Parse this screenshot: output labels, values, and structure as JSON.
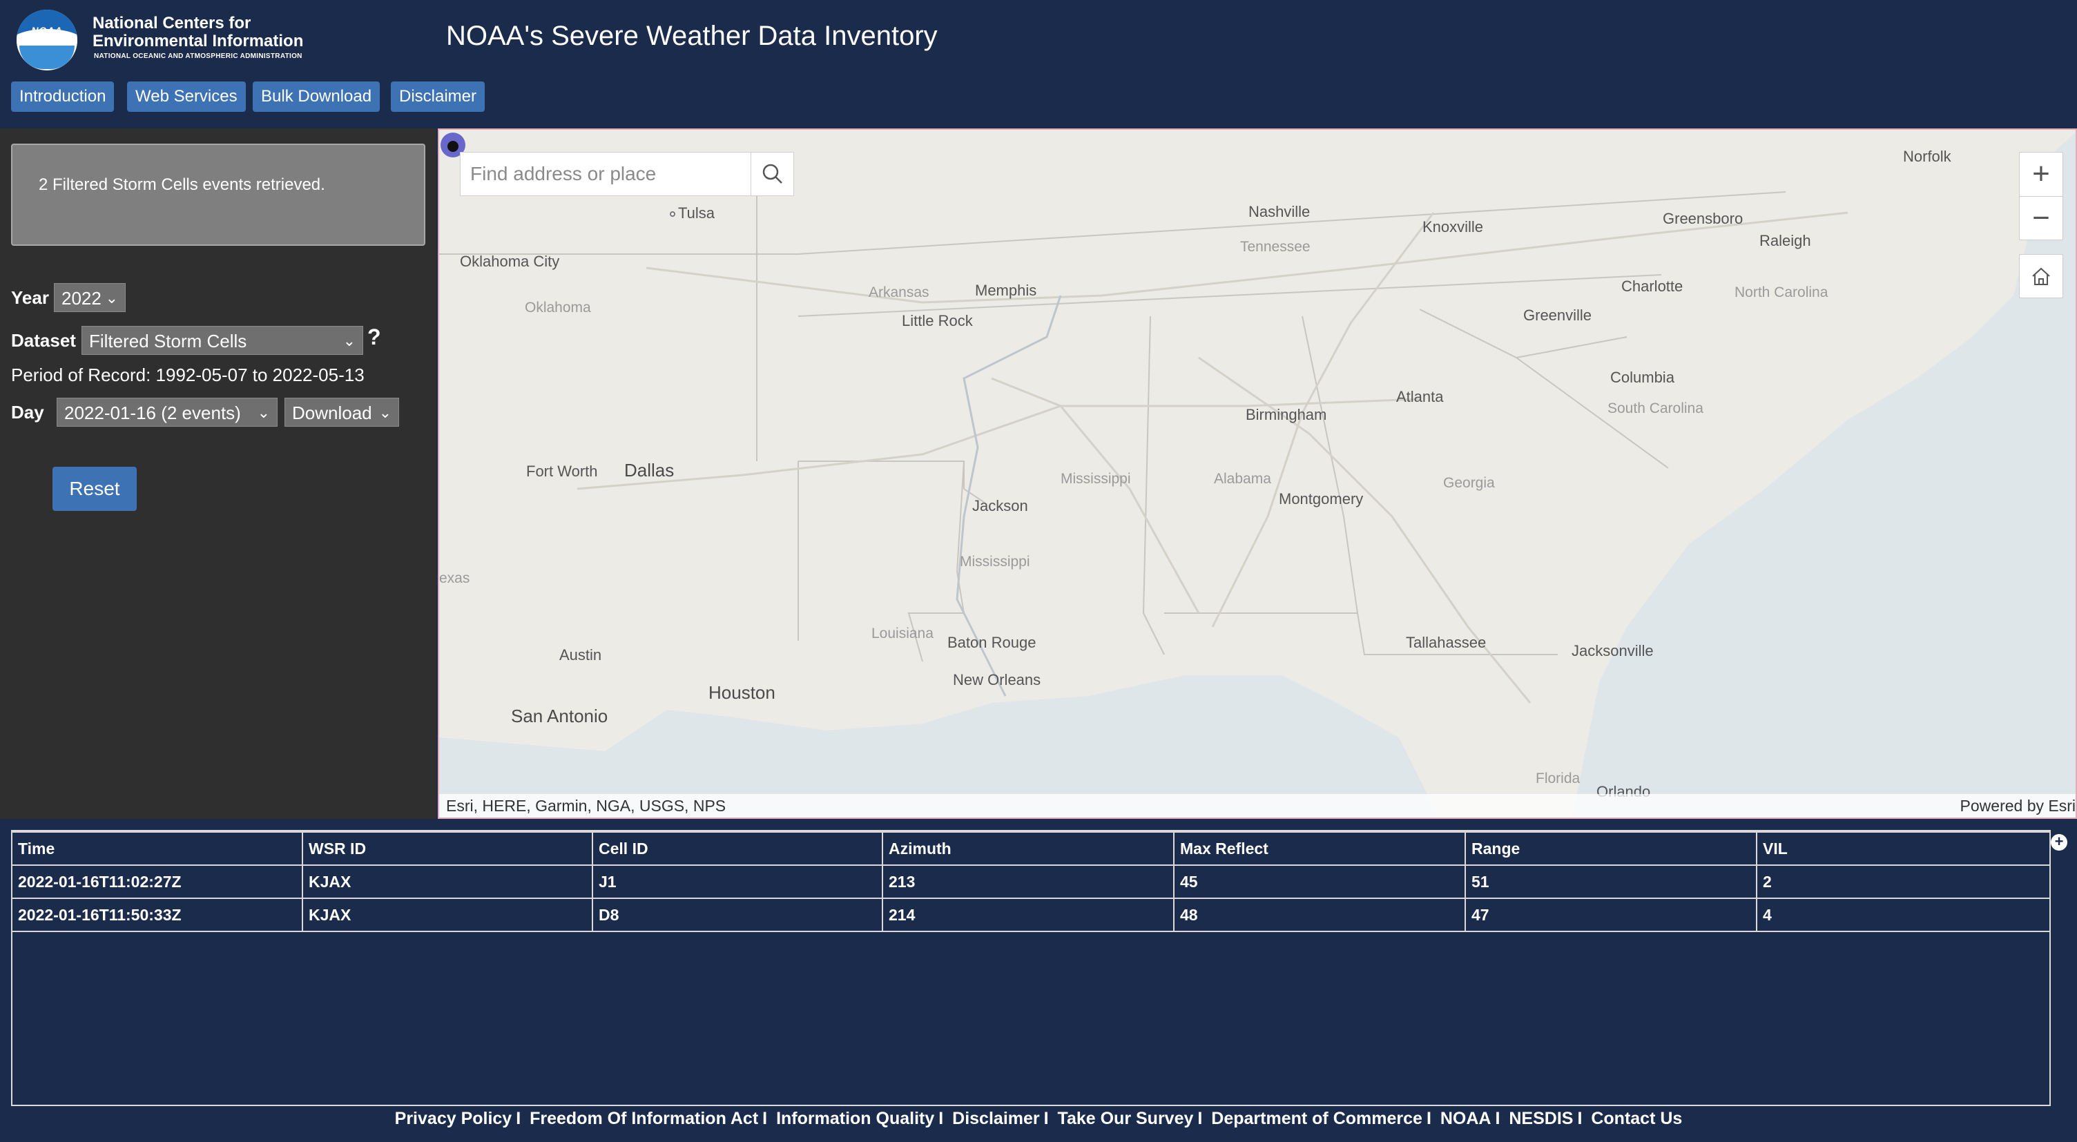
{
  "header": {
    "org_line1": "National Centers for",
    "org_line2": "Environmental Information",
    "org_line3": "NATIONAL OCEANIC AND ATMOSPHERIC ADMINISTRATION",
    "logo_text": "NOAA",
    "app_title": "NOAA's Severe Weather Data Inventory"
  },
  "nav": [
    "Introduction",
    "Web Services",
    "Bulk Download",
    "Disclaimer"
  ],
  "panel": {
    "status": "2 Filtered Storm Cells events retrieved.",
    "year_label": "Year",
    "year_value": "2022",
    "dataset_label": "Dataset",
    "dataset_value": "Filtered Storm Cells",
    "help": "?",
    "period": "Period of Record: 1992-05-07 to 2022-05-13",
    "day_label": "Day",
    "day_value": "2022-01-16 (2 events)",
    "download_value": "Download",
    "reset": "Reset"
  },
  "map": {
    "search_placeholder": "Find address or place",
    "attribution": "Esri, HERE, Garmin, NGA, USGS, NPS",
    "powered_by": "Powered by Esri",
    "cities": [
      "Tulsa",
      "Oklahoma City",
      "Nashville",
      "Knoxville",
      "Greensboro",
      "Raleigh",
      "Norfolk",
      "Memphis",
      "Little Rock",
      "Charlotte",
      "Greenville",
      "Columbia",
      "Atlanta",
      "Birmingham",
      "Dallas",
      "Fort Worth",
      "Jackson",
      "Montgomery",
      "Austin",
      "Houston",
      "San Antonio",
      "Baton Rouge",
      "New Orleans",
      "Tallahassee",
      "Jacksonville",
      "Orlando"
    ],
    "states": [
      "Oklahoma",
      "Tennessee",
      "Arkansas",
      "North Carolina",
      "South Carolina",
      "Mississippi",
      "Alabama",
      "Georgia",
      "Mississippi",
      "Louisiana",
      "Florida",
      "exas"
    ]
  },
  "table": {
    "columns": [
      "Time",
      "WSR ID",
      "Cell ID",
      "Azimuth",
      "Max Reflect",
      "Range",
      "VIL"
    ],
    "rows": [
      [
        "2022-01-16T11:02:27Z",
        "KJAX",
        "J1",
        "213",
        "45",
        "51",
        "2"
      ],
      [
        "2022-01-16T11:50:33Z",
        "KJAX",
        "D8",
        "214",
        "48",
        "47",
        "4"
      ]
    ]
  },
  "footer": [
    "Privacy Policy",
    "Freedom Of Information Act",
    "Information Quality",
    "Disclaimer",
    "Take Our Survey",
    "Department of Commerce",
    "NOAA",
    "NESDIS",
    "Contact Us"
  ],
  "colors": {
    "background": "#1a2b4c",
    "button": "#3d72b4",
    "panel": "#2f2f2f",
    "marker": "#5a5ac8"
  }
}
